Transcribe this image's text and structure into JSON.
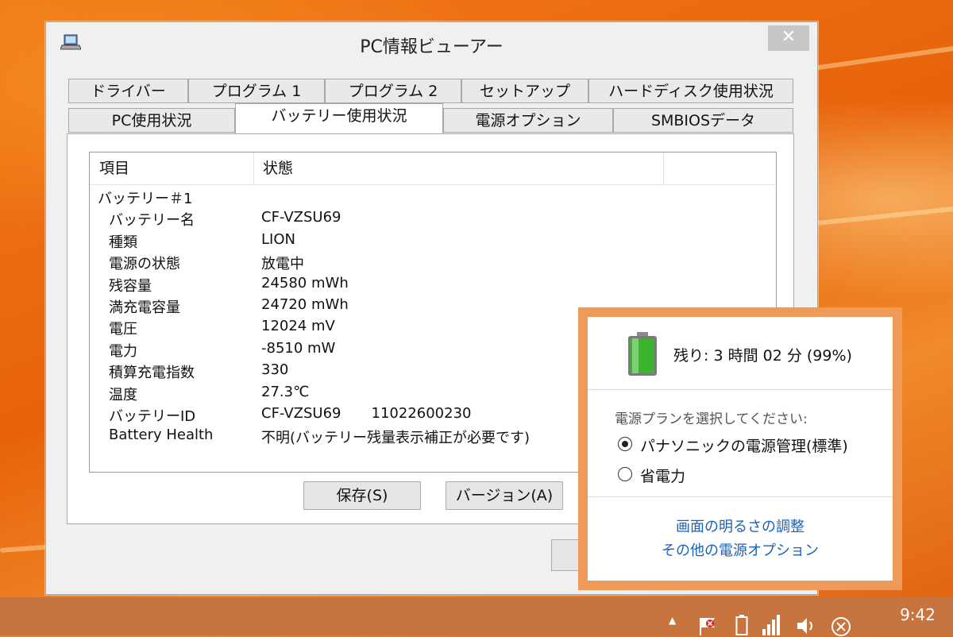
{
  "window": {
    "title": "PC情報ビューアー",
    "close_label": "✕"
  },
  "tabs_row1": [
    "ドライバー",
    "プログラム 1",
    "プログラム 2",
    "セットアップ",
    "ハードディスク使用状況"
  ],
  "tabs_row2": [
    "PC使用状況",
    "バッテリー使用状況",
    "電源オプション",
    "SMBIOSデータ"
  ],
  "active_tab": "バッテリー使用状況",
  "list": {
    "columns": [
      "項目",
      "状態"
    ],
    "rows": [
      {
        "item": "バッテリー＃1",
        "value": "",
        "indent": 0
      },
      {
        "item": "バッテリー名",
        "value": "CF-VZSU69",
        "indent": 1
      },
      {
        "item": "種類",
        "value": "LION",
        "indent": 1
      },
      {
        "item": "電源の状態",
        "value": "放電中",
        "indent": 1
      },
      {
        "item": "残容量",
        "value": "24580 mWh",
        "indent": 1
      },
      {
        "item": "満充電容量",
        "value": "24720 mWh",
        "indent": 1
      },
      {
        "item": "電圧",
        "value": "12024 mV",
        "indent": 1
      },
      {
        "item": "電力",
        "value": "-8510 mW",
        "indent": 1
      },
      {
        "item": "積算充電指数",
        "value": "330",
        "indent": 1
      },
      {
        "item": "温度",
        "value": "27.3℃",
        "indent": 1
      },
      {
        "item": "バッテリーID",
        "value": "CF-VZSU69",
        "extra": "11022600230",
        "indent": 1
      },
      {
        "item": "Battery Health",
        "value": "不明(バッテリー残量表示補正が必要です)",
        "indent": 1
      }
    ]
  },
  "buttons": {
    "save": "保存(S)",
    "version": "バージョン(A)"
  },
  "flyout": {
    "remaining": "残り: 3 時間 02 分 (99%)",
    "battery_percent": 99,
    "plan_prompt": "電源プランを選択してください:",
    "plans": [
      {
        "label": "パナソニックの電源管理(標準)",
        "selected": true
      },
      {
        "label": "省電力",
        "selected": false
      }
    ],
    "links": [
      "画面の明るさの調整",
      "その他の電源オプション"
    ]
  },
  "taskbar": {
    "time": "9:42",
    "tray_up": "▲"
  },
  "colors": {
    "desktop": "#e8630a",
    "flyout_border": "#f09a5a",
    "link": "#1a62b8",
    "battery_green": "#3bb52e"
  }
}
